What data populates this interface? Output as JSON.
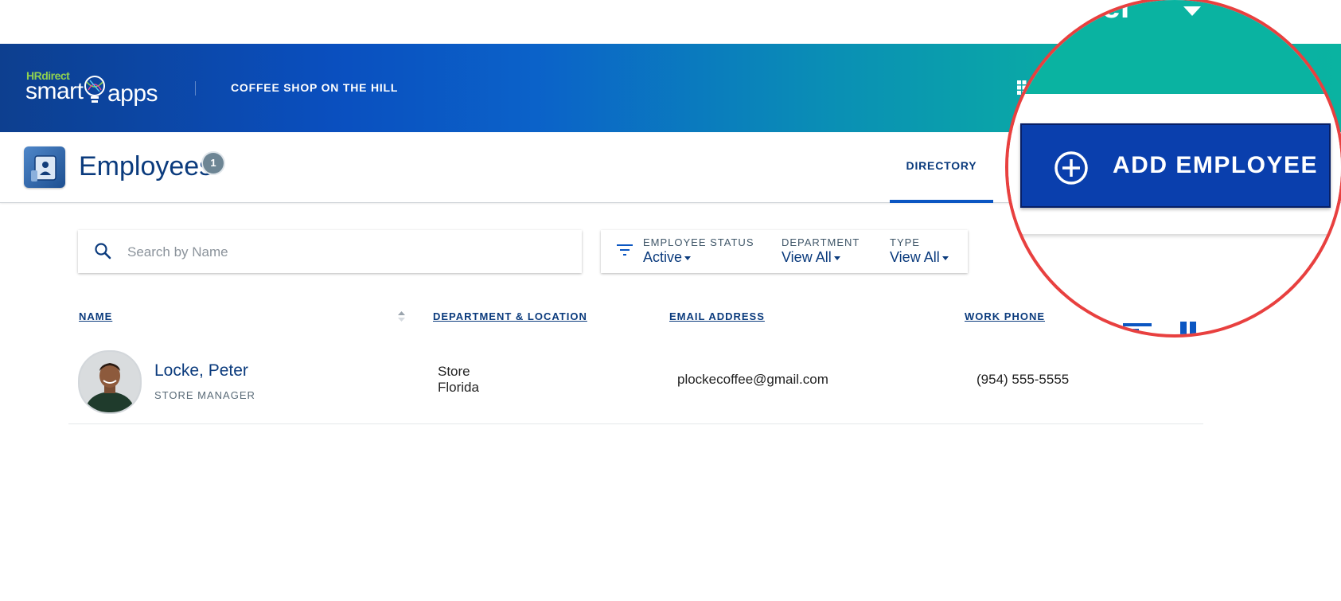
{
  "header": {
    "logo_hr": "HRdirect",
    "logo_smart": "smart",
    "logo_apps": "apps",
    "company": "COFFEE SHOP ON THE HILL",
    "user_name_partial": "eter"
  },
  "subheader": {
    "title": "Employees",
    "badge": "1",
    "tab_directory": "DIRECTORY",
    "add_employee": "ADD EMPLOYEE"
  },
  "search": {
    "placeholder": "Search by Name"
  },
  "filters": {
    "status_label": "EMPLOYEE STATUS",
    "status_value": "Active",
    "department_label": "DEPARTMENT",
    "department_value": "View All",
    "type_label": "TYPE",
    "type_value": "View All"
  },
  "table": {
    "headers": [
      "NAME",
      "DEPARTMENT & LOCATION",
      "EMAIL ADDRESS",
      "WORK PHONE"
    ],
    "rows": [
      {
        "name": "Locke, Peter",
        "title": "STORE MANAGER",
        "department": "Store",
        "location": "Florida",
        "email": "plockecoffee@gmail.com",
        "phone": "(954) 555-5555"
      }
    ]
  },
  "colors": {
    "primary": "#0b3b7d",
    "accent": "#0b56c2",
    "highlight_ring": "#e8403f",
    "header_teal": "#0ab3a1"
  }
}
